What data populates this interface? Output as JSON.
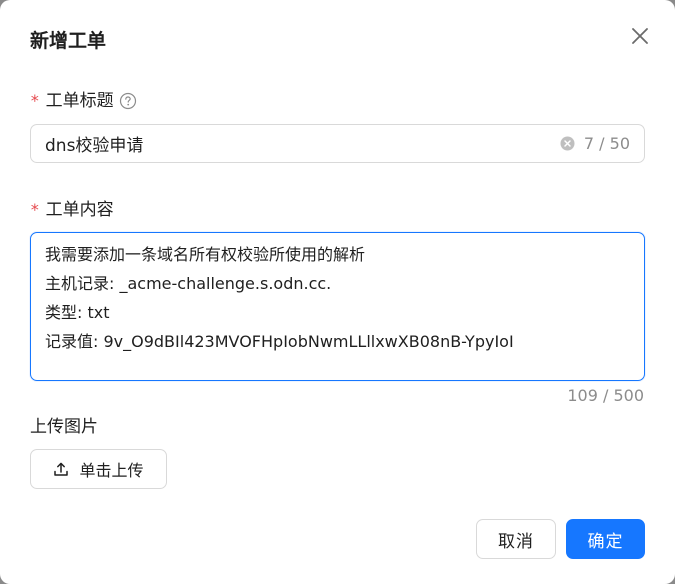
{
  "dialog": {
    "title": "新增工单",
    "close_icon": "close-icon"
  },
  "form": {
    "title_field": {
      "required_mark": "*",
      "label": "工单标题",
      "help_icon": "question-circle-icon",
      "value": "dns校验申请",
      "count": "7 / 50"
    },
    "content_field": {
      "required_mark": "*",
      "label": "工单内容",
      "lines": [
        "我需要添加一条域名所有权校验所使用的解析",
        "主机记录: _acme-challenge.s.odn.cc.",
        "类型: txt",
        "记录值: 9v_O9dBIl423MVOFHpIobNwmLLllxwXB08nB-YpyIoI"
      ],
      "count": "109 / 500"
    },
    "upload_field": {
      "label": "上传图片",
      "button_label": "单击上传",
      "button_icon": "upload-icon"
    }
  },
  "footer": {
    "cancel_label": "取消",
    "ok_label": "确定"
  },
  "colors": {
    "primary": "#1677ff",
    "required": "#e5484d",
    "border": "#d9d9d9",
    "muted": "#8c8c8c"
  }
}
